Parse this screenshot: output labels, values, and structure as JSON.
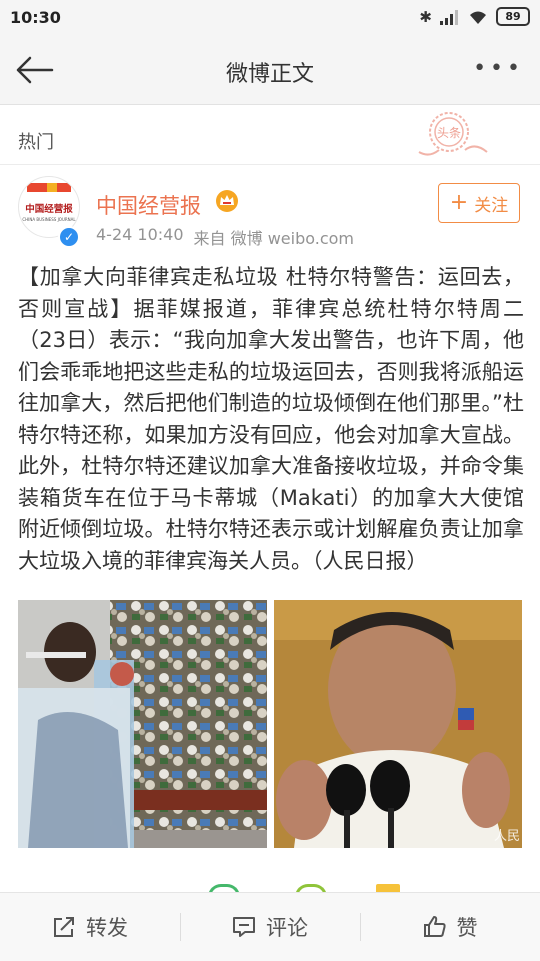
{
  "status_bar": {
    "time": "10:30",
    "battery": "89"
  },
  "header": {
    "title": "微博正文"
  },
  "section": {
    "label": "热门",
    "stamp_text": "头条"
  },
  "post": {
    "author": "中国经营报",
    "avatar_text": "中国经营报",
    "avatar_subtext": "CHINA BUSINESS JOURNAL",
    "timestamp": "4-24 10:40",
    "source": "来自 微博 weibo.com",
    "follow_label": "关注",
    "body": "【加拿大向菲律宾走私垃圾 杜特尔特警告：运回去，否则宣战】据菲媒报道，菲律宾总统杜特尔特周二（23日）表示：“我向加拿大发出警告，也许下周，他们会乖乖地把这些走私的垃圾运回去，否则我将派船运往加拿大，然后把他们制造的垃圾倾倒在他们那里。”杜特尔特还称，如果加方没有回应，他会对加拿大宣战。此外，杜特尔特还建议加拿大准备接收垃圾，并命令集装箱货车在位于马卡蒂城（Makati）的加拿大大使馆附近倾倒垃圾。杜特尔特还表示或计划解雇负责让加拿大垃圾入境的菲律宾海关人员。（人民日报）",
    "image_watermark": "人民"
  },
  "actions": {
    "repost": "转发",
    "comment": "评论",
    "like": "赞"
  },
  "colors": {
    "accent": "#eb7350",
    "follow": "#f28c45",
    "verified": "#2e8ff0"
  }
}
